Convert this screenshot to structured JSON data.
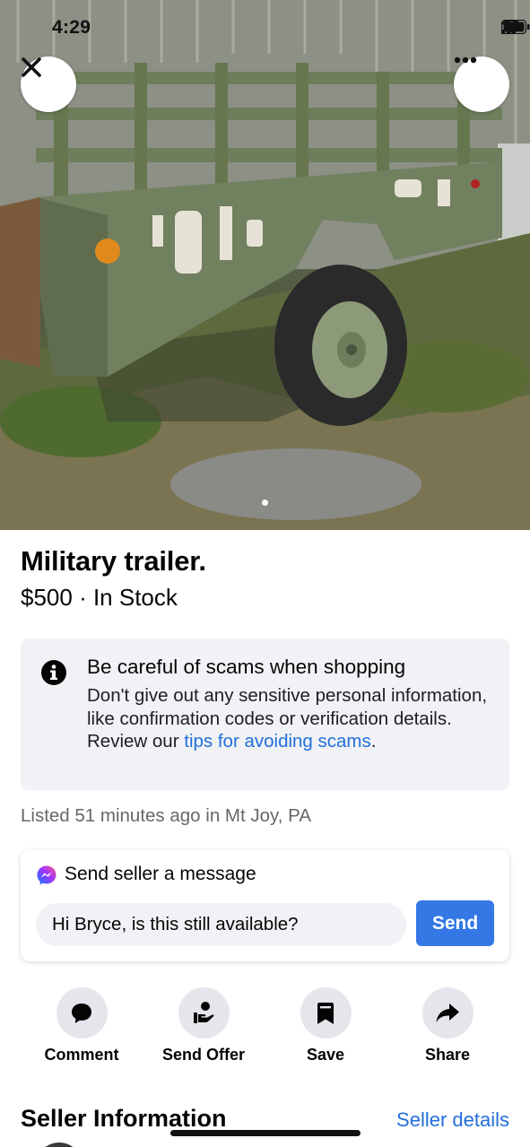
{
  "status_bar": {
    "time": "4:29",
    "icons": [
      "signal-icon",
      "wifi-icon",
      "battery-icon"
    ]
  },
  "photo": {
    "description_icons": [
      "close-icon",
      "more-icon"
    ],
    "carousel": {
      "count": 2,
      "active_index": 0
    }
  },
  "listing": {
    "title": "Military trailer.",
    "price_line": "$500 · In Stock",
    "listed": "Listed 51 minutes ago in Mt Joy, PA"
  },
  "scam_notice": {
    "heading": "Be careful of scams when shopping",
    "body_text": "Don't give out any sensitive personal information, like confirmation codes or verification details. Review our ",
    "link_text": "tips for avoiding scams",
    "end_text": "."
  },
  "message": {
    "heading": "Send seller a message",
    "input_value": "Hi Bryce, is this still available?",
    "send_label": "Send"
  },
  "actions": [
    {
      "label": "Comment",
      "icon": "comment-icon"
    },
    {
      "label": "Send Offer",
      "icon": "send-offer-icon"
    },
    {
      "label": "Save",
      "icon": "bookmark-icon"
    },
    {
      "label": "Share",
      "icon": "share-icon"
    }
  ],
  "seller": {
    "title": "Seller Information",
    "link": "Seller details"
  },
  "colors": {
    "link": "#216fdb",
    "send_button": "#3578e5",
    "card_bg": "#f0f2f5"
  }
}
